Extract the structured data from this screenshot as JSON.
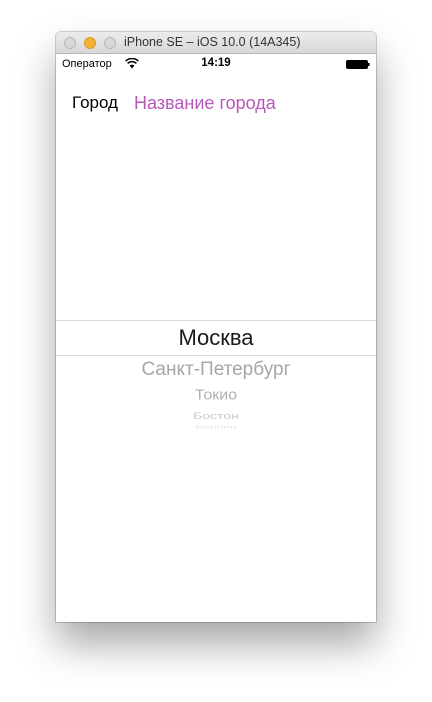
{
  "window": {
    "title": "iPhone SE – iOS 10.0 (14A345)"
  },
  "statusbar": {
    "carrier": "Оператор",
    "time": "14:19",
    "wifi_icon": "wifi-icon",
    "battery_icon": "battery-icon"
  },
  "form": {
    "city_label": "Город",
    "city_placeholder": "Название города"
  },
  "picker": {
    "selected": "Москва",
    "options": [
      "Санкт-Петербург",
      "Токио",
      "Бостон",
      "Берлин"
    ]
  },
  "colors": {
    "accent": "#b558b8",
    "picker_selected": "#1a1a1a",
    "picker_dim": "#a6a6a6"
  }
}
